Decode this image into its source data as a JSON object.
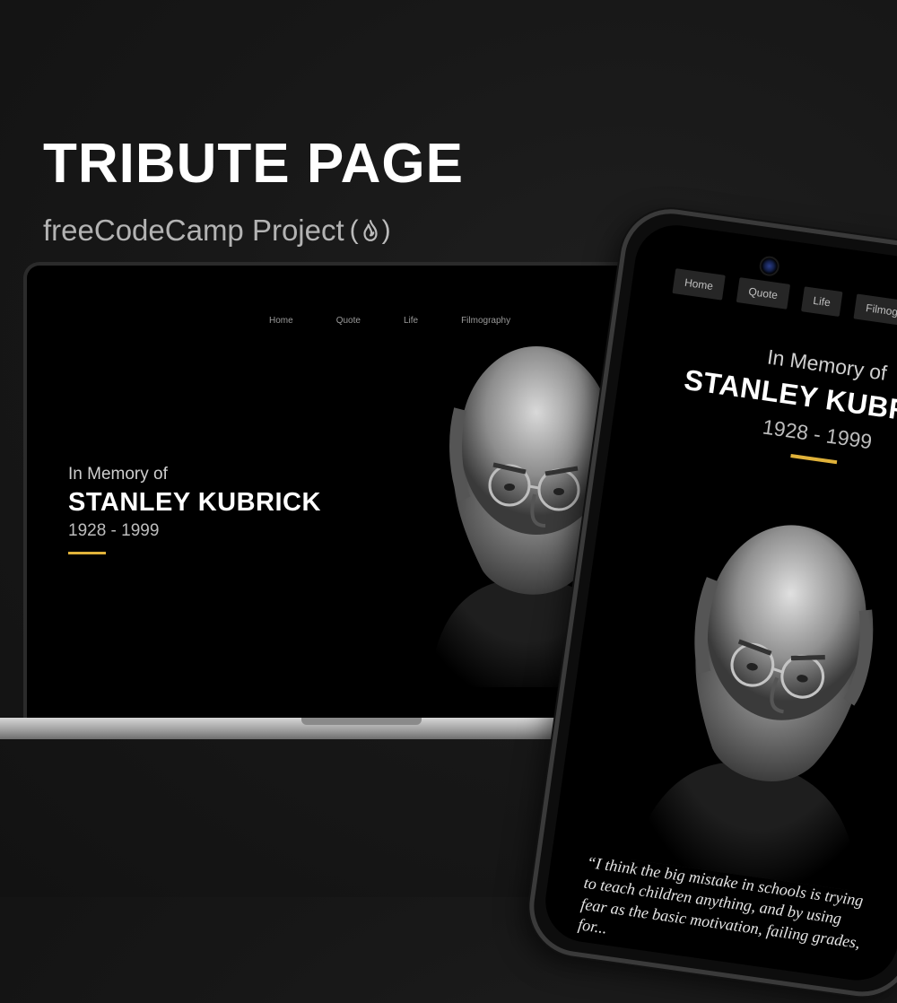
{
  "hero": {
    "title": "TRIBUTE PAGE",
    "subtitle": "freeCodeCamp Project",
    "logo_open": "(",
    "logo_close": ")"
  },
  "tribute": {
    "in_memory": "In Memory of",
    "name": "STANLEY KUBRICK",
    "years": "1928 - 1999",
    "quote": "“I think the big mistake in schools is trying to teach children anything, and by using fear as the basic motivation, failing grades, for..."
  },
  "laptop": {
    "nav": [
      "Home",
      "Quote",
      "Life",
      "Filmography"
    ]
  },
  "phone": {
    "nav": [
      "Home",
      "Quote",
      "Life",
      "Filmography"
    ]
  },
  "colors": {
    "accent": "#e0b23a",
    "background": "#171717",
    "screen": "#000000"
  },
  "icons": [
    "fcc-flame-icon",
    "camera-icon"
  ]
}
